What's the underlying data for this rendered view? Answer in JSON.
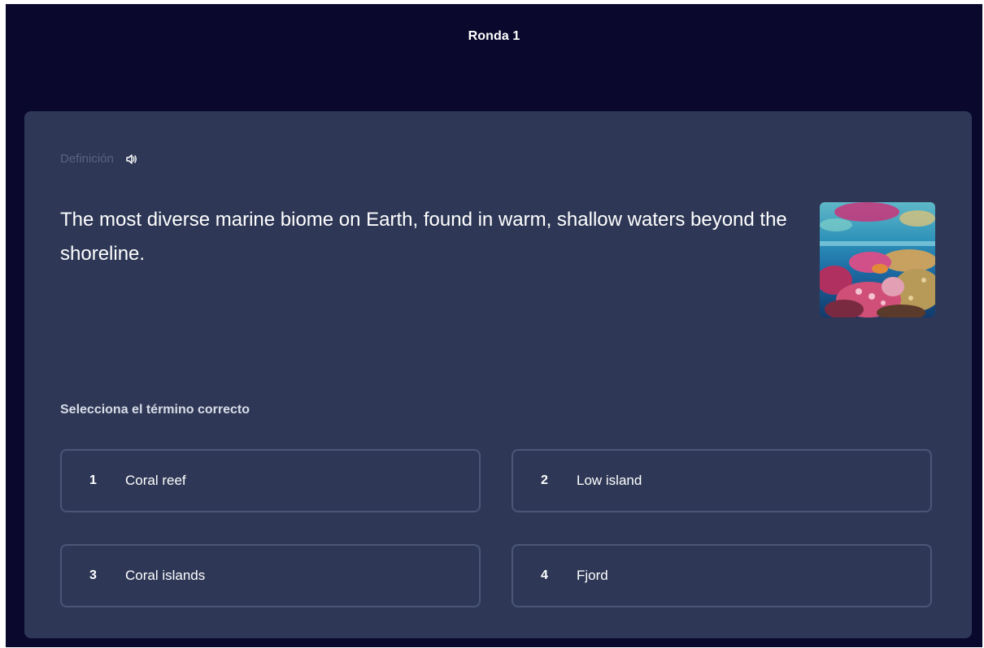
{
  "header": {
    "title": "Ronda 1"
  },
  "card": {
    "label": "Definición",
    "audio_icon": "speaker-icon",
    "definition": "The most diverse marine biome on Earth, found in warm, shallow waters beyond the shoreline.",
    "image_icon": "coral-reef-photo",
    "prompt": "Selecciona el término correcto"
  },
  "options": [
    {
      "number": "1",
      "term": "Coral reef"
    },
    {
      "number": "2",
      "term": "Low island"
    },
    {
      "number": "3",
      "term": "Coral islands"
    },
    {
      "number": "4",
      "term": "Fjord"
    }
  ],
  "colors": {
    "page_background": "#0a092d",
    "card_background": "#2e3856",
    "option_border": "#4b5575",
    "muted_label": "#586380",
    "text": "#ffffff"
  }
}
